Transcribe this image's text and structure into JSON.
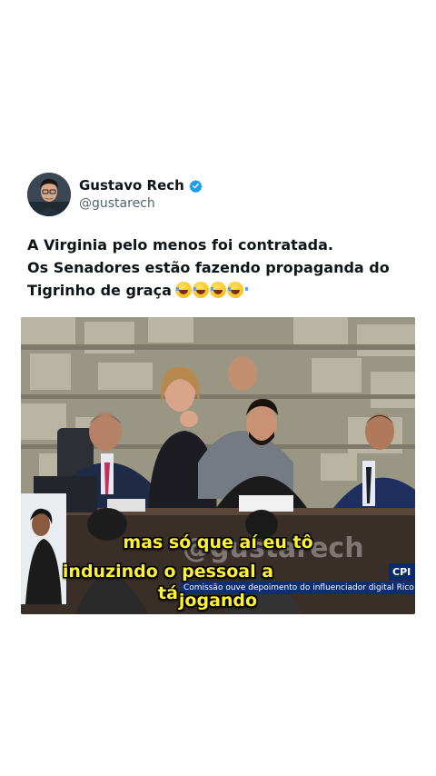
{
  "author": {
    "display_name": "Gustavo Rech",
    "handle": "@gustarech",
    "verified_icon": "verified-badge-icon",
    "verified_color": "#1d9bf0"
  },
  "tweet": {
    "line1": "A Virginia pelo menos foi contratada.",
    "line2": "Os Senadores estão fazendo propaganda do",
    "line3": "Tigrinho de graça",
    "emoji": "😂😂😂😂"
  },
  "media": {
    "caption_line1": "mas só que aí eu tô",
    "caption_line2": "induzindo o pessoal a tá",
    "caption_line3": "jogando",
    "caption_color": "#fff230",
    "watermark": "@gustarech",
    "channel_label": "CPI DAS",
    "ticker": "Comissão ouve depoimento do influenciador digital Rico M"
  }
}
